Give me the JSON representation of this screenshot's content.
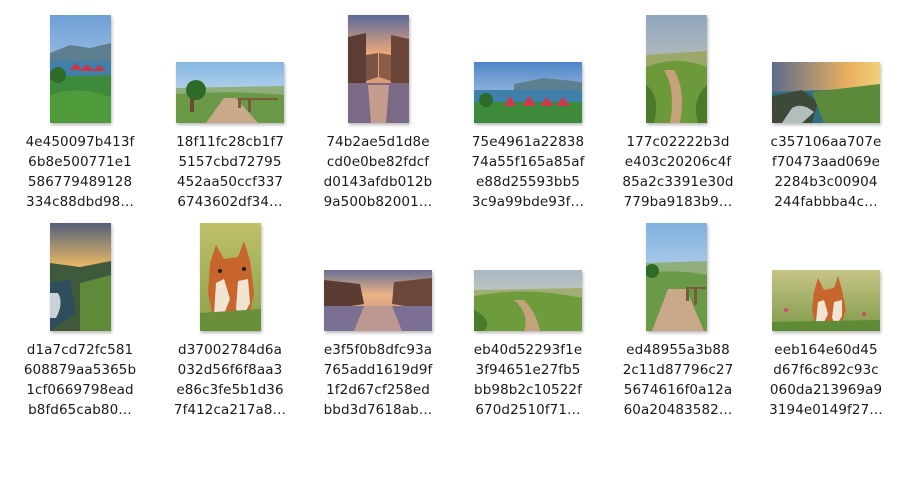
{
  "files": [
    {
      "lines": [
        "4e450097b413f",
        "6b8e500771e1",
        "586779489128",
        "334c88dbd98…"
      ],
      "image": "lake-village-red-roofs"
    },
    {
      "lines": [
        "18f11fc28cb1f7",
        "5157cbd72795",
        "452aa50ccf337",
        "6743602df34…"
      ],
      "image": "stone-terrace-overlook"
    },
    {
      "lines": [
        "74b2ae5d1d8e",
        "cd0e0be82fdcf",
        "d0143afdb012b",
        "9a500b82001…"
      ],
      "image": "canal-town-sunset"
    },
    {
      "lines": [
        "75e4961a22838",
        "74a55f165a85af",
        "e88d25593bb5",
        "3c9a99bde93f…"
      ],
      "image": "lake-village-red-roofs"
    },
    {
      "lines": [
        "177c02222b3d",
        "e403c20206c4f",
        "85a2c3391e30d",
        "779ba9183b9…"
      ],
      "image": "green-ridge-path"
    },
    {
      "lines": [
        "c357106aa707e",
        "f70473aad069e",
        "2284b3c00904",
        "244fabbba4c…"
      ],
      "image": "sea-cliff-sunset"
    },
    {
      "lines": [
        "d1a7cd72fc581",
        "608879aa5365b",
        "1cf0669798ead",
        "b8fd65cab80…"
      ],
      "image": "sea-cliff-sunset"
    },
    {
      "lines": [
        "d37002784d6a",
        "032d56f6f8aa3",
        "e86c3fe5b1d36",
        "7f412ca217a8…"
      ],
      "image": "fox-cubs"
    },
    {
      "lines": [
        "e3f5f0b8dfc93a",
        "765add1619d9f",
        "1f2d67cf258ed",
        "bbd3d7618ab…"
      ],
      "image": "canal-town-sunset"
    },
    {
      "lines": [
        "eb40d52293f1e",
        "3f94651e27fb5",
        "bb98b2c10522f",
        "670d2510f71…"
      ],
      "image": "green-ridge-path"
    },
    {
      "lines": [
        "ed48955a3b88",
        "2c11d87796c27",
        "5674616f0a12a",
        "60a20483582…"
      ],
      "image": "stone-terrace-overlook"
    },
    {
      "lines": [
        "eeb164e60d45",
        "d67f6c892c93c",
        "060da213969a9",
        "3194e0149f27…"
      ],
      "image": "fox-cubs"
    }
  ]
}
